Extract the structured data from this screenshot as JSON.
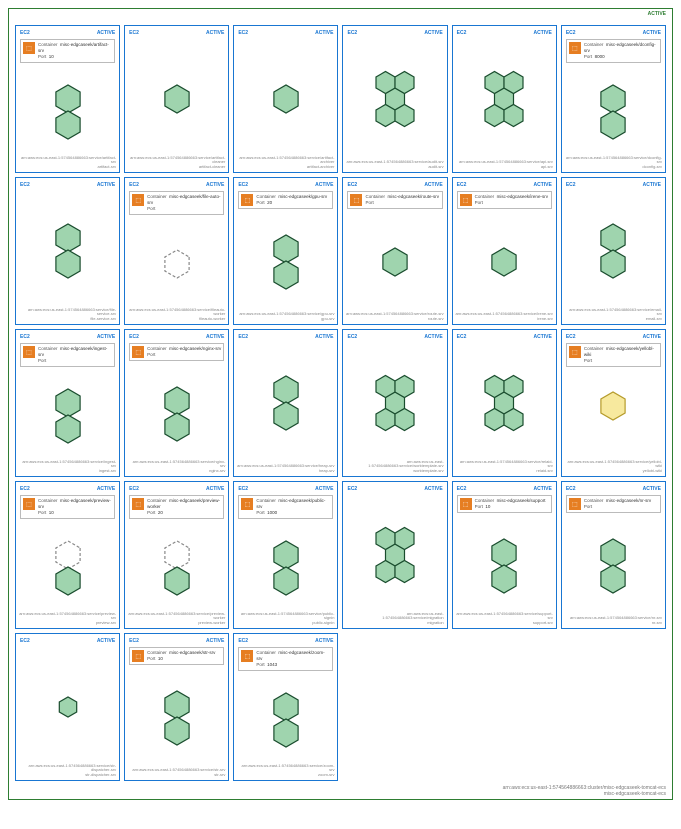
{
  "cluster": {
    "status": "ACTIVE",
    "footer_line1": "arn:aws:ecs:us-east-1:574564886663:cluster/misc-edgcaseek-tomcat-ecs",
    "footer_line2": "misc-edgcaseek-tomcat-ecs"
  },
  "card_type": "EC2",
  "card_status": "ACTIVE",
  "info_label_container": "Container",
  "info_label_port": "Port",
  "arn_prefix": "arn:aws:ecs:us-east-1:574564886663:service/",
  "cards": [
    {
      "container": "misc-edgcaseek/artifact-srv",
      "port": "10",
      "name": "artifact-srv",
      "shape": "double",
      "height": "tall"
    },
    {
      "container": "",
      "port": "",
      "name": "artifact-cleaner",
      "shape": "single",
      "height": "short",
      "noinfo": true
    },
    {
      "container": "",
      "port": "",
      "name": "artifact-archiver",
      "shape": "single",
      "height": "short",
      "noinfo": true
    },
    {
      "container": "",
      "port": "",
      "name": "audit-srv",
      "shape": "cluster5",
      "height": "tall",
      "noinfo": true
    },
    {
      "container": "",
      "port": "",
      "name": "api-srv",
      "shape": "cluster5",
      "height": "tall",
      "noinfo": true
    },
    {
      "container": "misc-edgcaseek/dconfig-srv",
      "port": "8000",
      "name": "dconfig-srv",
      "shape": "double",
      "height": "tall"
    },
    {
      "container": "",
      "port": "",
      "name": "file-service-srv",
      "shape": "double",
      "height": "tall",
      "noinfo": true
    },
    {
      "container": "misc-edgcaseek/file-auto-srv",
      "port": "",
      "name": "fileauto-worker",
      "shape": "dashed",
      "height": "short"
    },
    {
      "container": "misc-edgcaseek/gpu-srv",
      "port": "20",
      "name": "gpu-srv",
      "shape": "double",
      "height": "tall"
    },
    {
      "container": "misc-edgcaseek/route-srv",
      "port": "",
      "name": "route-srv",
      "shape": "single",
      "height": "tall"
    },
    {
      "container": "misc-edgcaseek/irene-srv",
      "port": "",
      "name": "irene-srv",
      "shape": "single",
      "height": "tall"
    },
    {
      "container": "",
      "port": "",
      "name": "email-srv",
      "shape": "double",
      "height": "tall",
      "noinfo": true
    },
    {
      "container": "misc-edgcaseek/ingest-srv",
      "port": "",
      "name": "ingest-srv",
      "shape": "double",
      "height": "tall"
    },
    {
      "container": "misc-edgcaseek/nginx-srv",
      "port": "",
      "name": "nginx-srv",
      "shape": "double",
      "height": "tall"
    },
    {
      "container": "",
      "port": "",
      "name": "heap-srv",
      "shape": "double",
      "height": "tall",
      "noinfo": true
    },
    {
      "container": "",
      "port": "",
      "name": "worktemplate-srv",
      "shape": "cluster5",
      "height": "tall",
      "noinfo": true
    },
    {
      "container": "",
      "port": "",
      "name": "relaid-srv",
      "shape": "cluster5",
      "height": "tall",
      "noinfo": true
    },
    {
      "container": "misc-edgcaseek/yellobl-wiki",
      "port": "",
      "name": "yellobl-wiki",
      "shape": "yellow",
      "height": "tall"
    },
    {
      "container": "misc-edgcaseek/preview-srv",
      "port": "10",
      "name": "preview-srv",
      "shape": "dashed-over",
      "height": "tall"
    },
    {
      "container": "misc-edgcaseek/preview-worker",
      "port": "20",
      "name": "preview-worker",
      "shape": "dashed-over",
      "height": "tall"
    },
    {
      "container": "misc-edgcaseek/public-srv",
      "port": "1000",
      "name": "public-signin",
      "shape": "double",
      "height": "tall"
    },
    {
      "container": "",
      "port": "",
      "name": "migration",
      "shape": "cluster5",
      "height": "tall",
      "noinfo": true
    },
    {
      "container": "misc-edgcaseek/support",
      "port": "10",
      "name": "support-srv",
      "shape": "double",
      "height": "tall"
    },
    {
      "container": "misc-edgcaseek/nr-srv",
      "port": "",
      "name": "nr-srv",
      "shape": "double",
      "height": "tall"
    },
    {
      "container": "",
      "port": "",
      "name": "str-dispatcher-srv",
      "shape": "single-small",
      "height": "short",
      "noinfo": true
    },
    {
      "container": "misc-edgcaseek/str-srv",
      "port": "10",
      "name": "str-srv",
      "shape": "double",
      "height": "tall"
    },
    {
      "container": "misc-edgcaseek/zoom-srv",
      "port": "1043",
      "name": "zoom-srv",
      "shape": "double",
      "height": "tall"
    }
  ]
}
